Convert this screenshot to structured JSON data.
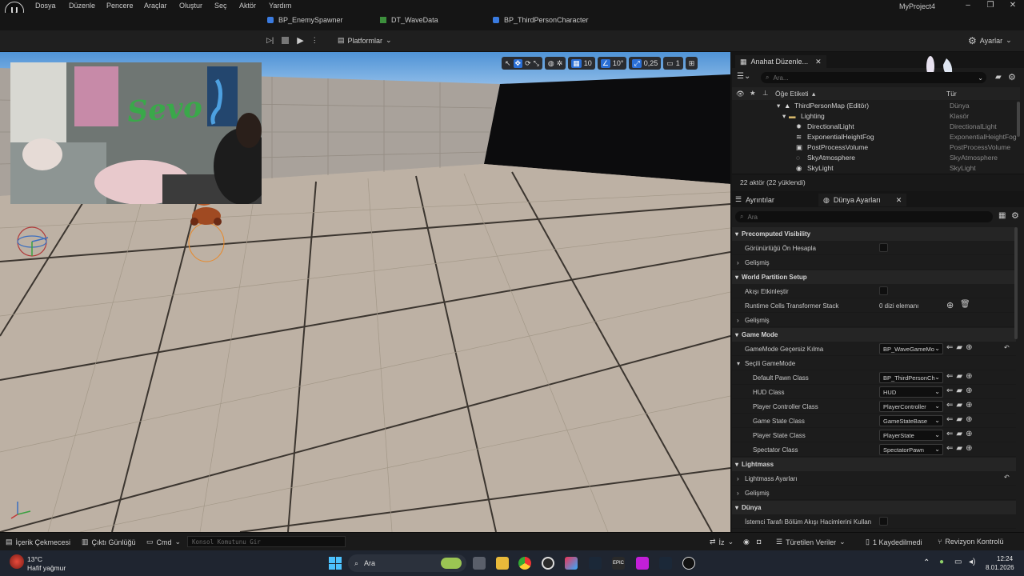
{
  "menu": {
    "items": [
      "Dosya",
      "Düzenle",
      "Pencere",
      "Araçlar",
      "Oluştur",
      "Seç",
      "Aktör",
      "Yardım"
    ],
    "project_title": "MyProject4"
  },
  "doc_tabs": [
    {
      "label": "BP_EnemySpawner",
      "icon": "blueprint-icon"
    },
    {
      "label": "DT_WaveData",
      "icon": "datatable-icon"
    },
    {
      "label": "BP_ThirdPersonCharacter",
      "icon": "blueprint-icon"
    }
  ],
  "toolbar": {
    "platforms_label": "Platformlar",
    "settings_label": "Ayarlar"
  },
  "viewport_toolbar": {
    "grid_snap": "10",
    "rotation_snap": "10°",
    "scale_snap": "0,25",
    "camera_speed": "1"
  },
  "outliner": {
    "tab_label": "Anahat Düzenle...",
    "search_placeholder": "Ara...",
    "col_label": "Öğe Etiketi",
    "col_type": "Tür",
    "rows": [
      {
        "label": "ThirdPersonMap (Editör)",
        "type": "Dünya"
      },
      {
        "label": "Lighting",
        "type": "Klasör"
      },
      {
        "label": "DirectionalLight",
        "type": "DirectionalLight"
      },
      {
        "label": "ExponentialHeightFog",
        "type": "ExponentialHeightFog"
      },
      {
        "label": "PostProcessVolume",
        "type": "PostProcessVolume"
      },
      {
        "label": "SkyAtmosphere",
        "type": "SkyAtmosphere"
      },
      {
        "label": "SkyLight",
        "type": "SkyLight"
      }
    ],
    "footer": "22 aktör (22 yüklendi)"
  },
  "details": {
    "tab_details": "Ayrıntılar",
    "tab_world": "Dünya Ayarları",
    "search_placeholder": "Ara",
    "sections": {
      "precomputed": "Precomputed Visibility",
      "visibility_label": "Görünürlüğü Ön Hesapla",
      "advanced1": "Gelişmiş",
      "wp_setup": "World Partition Setup",
      "enable_streaming": "Akışı Etkinleştir",
      "runtime_cells": "Runtime Cells Transformer Stack",
      "runtime_cells_value": "0 dizi elemanı",
      "advanced2": "Gelişmiş",
      "game_mode": "Game Mode",
      "gm_override": "GameMode Geçersiz Kılma",
      "gm_override_value": "BP_WaveGameMo",
      "selected_gm": "Seçili GameMode",
      "lightmass": "Lightmass",
      "lightmass_settings": "Lightmass Ayarları",
      "advanced3": "Gelişmiş",
      "world": "Dünya",
      "client_streaming": "İstemci Tarafı Bölüm Akışı Hacimlerini Kullan"
    },
    "gm_rows": [
      {
        "label": "Default Pawn Class",
        "value": "BP_ThirdPersonCh"
      },
      {
        "label": "HUD Class",
        "value": "HUD"
      },
      {
        "label": "Player Controller Class",
        "value": "PlayerController"
      },
      {
        "label": "Game State Class",
        "value": "GameStateBase"
      },
      {
        "label": "Player State Class",
        "value": "PlayerState"
      },
      {
        "label": "Spectator Class",
        "value": "SpectatorPawn"
      }
    ]
  },
  "statusbar": {
    "content_drawer": "İçerik Çekmecesi",
    "output_log": "Çıktı Günlüğü",
    "cmd": "Cmd",
    "console_placeholder": "Konsol Komutunu Gir",
    "trace": "İz",
    "derived_data": "Türetilen Veriler",
    "unsaved": "1 Kaydedilmedi",
    "revision": "Revizyon Kontrolü"
  },
  "taskbar": {
    "weather_temp": "13°C",
    "weather_desc": "Hafif yağmur",
    "search_label": "Ara",
    "time": "12:24",
    "date": "8.01.2026"
  },
  "webcam": {
    "wall_text": "Sevo"
  },
  "colors": {
    "accent": "#2a6fd6",
    "panel_bg": "#1c1c1c",
    "floor": "#bdb1a4"
  }
}
